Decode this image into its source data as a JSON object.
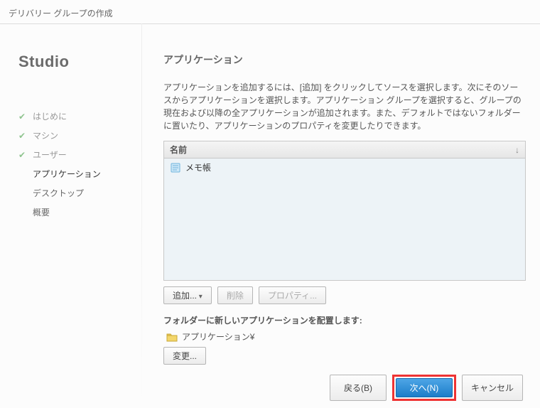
{
  "window_title": "デリバリー グループの作成",
  "sidebar": {
    "title": "Studio",
    "items": [
      {
        "label": "はじめに",
        "done": true
      },
      {
        "label": "マシン",
        "done": true
      },
      {
        "label": "ユーザー",
        "done": true
      },
      {
        "label": "アプリケーション",
        "active": true
      },
      {
        "label": "デスクトップ"
      },
      {
        "label": "概要"
      }
    ]
  },
  "content": {
    "title": "アプリケーション",
    "description": "アプリケーションを追加するには、[追加] をクリックしてソースを選択します。次にそのソースからアプリケーションを選択します。アプリケーション グループを選択すると、グループの現在および以降の全アプリケーションが追加されます。また、デフォルトではないフォルダーに置いたり、アプリケーションのプロパティを変更したりできます。",
    "table": {
      "header": "名前",
      "rows": [
        {
          "name": "メモ帳"
        }
      ]
    },
    "buttons": {
      "add": "追加...",
      "remove": "削除",
      "properties": "プロパティ..."
    },
    "folder": {
      "label": "フォルダーに新しいアプリケーションを配置します:",
      "path": "アプリケーション¥",
      "change": "変更..."
    }
  },
  "footer": {
    "back": "戻る(B)",
    "next": "次へ(N)",
    "cancel": "キャンセル"
  }
}
